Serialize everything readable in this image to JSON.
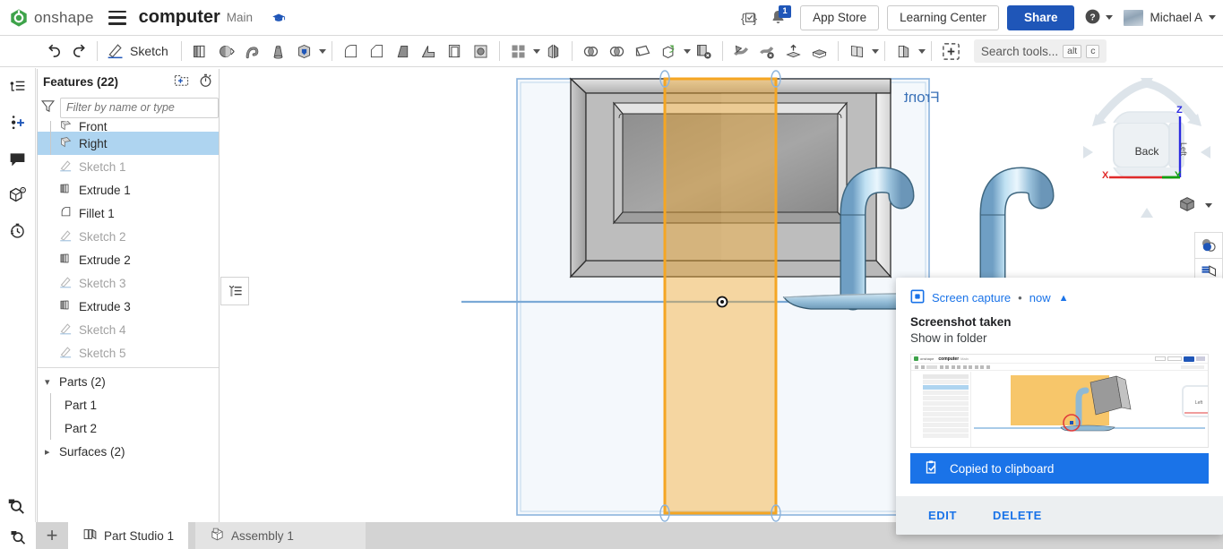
{
  "header": {
    "brand": "onshape",
    "menu_icon": "hamburger-icon",
    "document_title": "computer",
    "branch": "Main",
    "badge_icon": "graduation-cap-icon",
    "code_icon": "featurescript-icon",
    "bell_icon": "notification-bell-icon",
    "bell_count": "1",
    "app_store": "App Store",
    "learning_center": "Learning Center",
    "share": "Share",
    "help_icon": "help-circle-icon",
    "user_name": "Michael A",
    "accent_blue": "#1f56b8"
  },
  "toolbar": {
    "undo": "undo-icon",
    "redo": "redo-icon",
    "sketch_label": "Sketch",
    "items": [
      "extrude-icon",
      "revolve-icon",
      "sweep-icon",
      "loft-icon",
      "thicken-icon",
      "fillet-icon",
      "chamfer-icon",
      "draft-icon",
      "rib-icon",
      "shell-icon",
      "hole-icon",
      "boolean-icon",
      "plane-icon",
      "transform-icon",
      "delete-face-icon",
      "split-icon",
      "delete-part-icon",
      "move-face-icon",
      "replace-face-icon",
      "mirror-icon",
      "pattern-icon",
      "more-tools-icon"
    ],
    "search_placeholder": "Search tools...",
    "kbd_alt": "alt",
    "kbd_key": "c"
  },
  "left_rail": {
    "items": [
      {
        "name": "feature-list-icon"
      },
      {
        "name": "insert-part-icon"
      },
      {
        "name": "comments-icon"
      },
      {
        "name": "parts-bom-icon"
      },
      {
        "name": "version-history-icon"
      }
    ],
    "bottom": {
      "name": "magnifier-cube-icon"
    }
  },
  "features_panel": {
    "title": "Features (22)",
    "new_folder_icon": "new-folder-icon",
    "rollback_icon": "rollback-timer-icon",
    "filter_icon": "filter-funnel-icon",
    "filter_placeholder": "Filter by name or type",
    "flyout_icon": "feature-list-flyout-icon",
    "tree": [
      {
        "label": "Front",
        "icon": "plane-icon",
        "state": "clipped",
        "level": 1
      },
      {
        "label": "Right",
        "icon": "plane-icon",
        "state": "selected",
        "level": 1
      },
      {
        "label": "Sketch 1",
        "icon": "sketch-icon",
        "state": "dim",
        "level": 0
      },
      {
        "label": "Extrude 1",
        "icon": "extrude-icon",
        "state": "normal",
        "level": 0
      },
      {
        "label": "Fillet 1",
        "icon": "fillet-icon",
        "state": "normal",
        "level": 0
      },
      {
        "label": "Sketch 2",
        "icon": "sketch-icon",
        "state": "dim",
        "level": 0
      },
      {
        "label": "Extrude 2",
        "icon": "extrude-icon",
        "state": "normal",
        "level": 0
      },
      {
        "label": "Sketch 3",
        "icon": "sketch-icon",
        "state": "dim",
        "level": 0
      },
      {
        "label": "Extrude 3",
        "icon": "extrude-icon",
        "state": "normal",
        "level": 0
      },
      {
        "label": "Sketch 4",
        "icon": "sketch-icon",
        "state": "dim",
        "level": 0
      },
      {
        "label": "Sketch 5",
        "icon": "sketch-icon",
        "state": "dim",
        "level": 0
      }
    ],
    "groups": [
      {
        "label": "Parts (2)",
        "expanded": true,
        "children": [
          "Part 1",
          "Part 2"
        ]
      },
      {
        "label": "Surfaces (2)",
        "expanded": false,
        "children": []
      }
    ]
  },
  "viewport": {
    "plane_label_front": "Front",
    "selected_plane_color": "#f5a623",
    "plane_outline_color": "#8cb4dd",
    "viewcube": {
      "face_label": "Back",
      "side_label": "Left",
      "axis_x": "X",
      "axis_y": "Y",
      "axis_z": "Z",
      "x_color": "#e02b2b",
      "y_color": "#10a010",
      "z_color": "#2b2be0"
    },
    "perspective_icon": "view-cube-icon",
    "right_tools": [
      {
        "name": "display-state-icon"
      },
      {
        "name": "section-view-icon"
      },
      {
        "name": "render-icon"
      },
      {
        "name": "measure-icon"
      }
    ]
  },
  "tabs": {
    "search_icon": "tab-search-icon",
    "add_label": "+",
    "items": [
      {
        "label": "Part Studio 1",
        "icon": "part-studio-icon",
        "active": true
      },
      {
        "label": "Assembly 1",
        "icon": "assembly-icon",
        "active": false
      }
    ]
  },
  "notification": {
    "app_icon": "screen-capture-icon",
    "app_name": "Screen capture",
    "separator": "•",
    "time": "now",
    "collapse_icon": "chevron-up-icon",
    "title": "Screenshot taken",
    "subtitle": "Show in folder",
    "toast_icon": "clipboard-check-icon",
    "toast_text": "Copied to clipboard",
    "toast_color": "#1a73e8",
    "edit_label": "EDIT",
    "delete_label": "DELETE"
  }
}
